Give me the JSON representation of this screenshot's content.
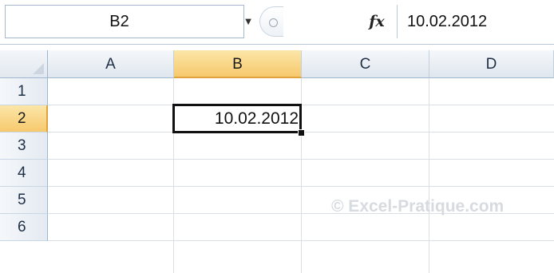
{
  "formula_bar": {
    "name_box": "B2",
    "dropdown_icon": "chevron-down-icon",
    "fx_label": "fx",
    "formula_value": "10.02.2012"
  },
  "grid": {
    "columns": [
      "A",
      "B",
      "C",
      "D"
    ],
    "rows": [
      "1",
      "2",
      "3",
      "4",
      "5",
      "6"
    ],
    "selected_column": "B",
    "selected_row": "2",
    "cells": {
      "B2": "10.02.2012"
    }
  },
  "watermark": "© Excel-Pratique.com",
  "colors": {
    "selection_header": "#f7c96d",
    "header_bg": "#e4eaf1",
    "gridline": "#dadfe5",
    "active_border": "#111111"
  }
}
